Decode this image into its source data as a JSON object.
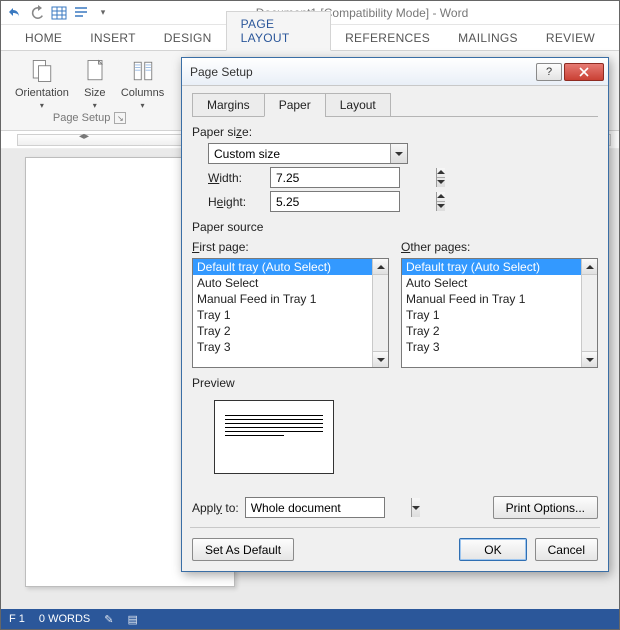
{
  "window": {
    "title": "Document1 [Compatibility Mode] - Word"
  },
  "ribbon": {
    "tabs": [
      "HOME",
      "INSERT",
      "DESIGN",
      "PAGE LAYOUT",
      "REFERENCES",
      "MAILINGS",
      "REVIEW"
    ],
    "active_index": 3,
    "buttons": {
      "orientation": "Orientation",
      "size": "Size",
      "columns": "Columns"
    },
    "group_label": "Page Setup"
  },
  "statusbar": {
    "page": "F 1",
    "words": "0 WORDS"
  },
  "dialog": {
    "title": "Page Setup",
    "tabs": [
      "Margins",
      "Paper",
      "Layout"
    ],
    "active_tab": 1,
    "paper_size_label": "Paper size:",
    "paper_size_value": "Custom size",
    "width_label": "Width:",
    "width_value": "7.25",
    "height_label": "Height:",
    "height_value": "5.25",
    "paper_source_label": "Paper source",
    "first_page_label": "First page:",
    "other_pages_label": "Other pages:",
    "tray_options": [
      "Default tray (Auto Select)",
      "Auto Select",
      "Manual Feed in Tray 1",
      "Tray 1",
      "Tray 2",
      "Tray 3"
    ],
    "first_page_selected": 0,
    "other_pages_selected": 0,
    "preview_label": "Preview",
    "apply_to_label": "Apply to:",
    "apply_to_value": "Whole document",
    "print_options_label": "Print Options...",
    "set_default_label": "Set As Default",
    "ok_label": "OK",
    "cancel_label": "Cancel"
  }
}
